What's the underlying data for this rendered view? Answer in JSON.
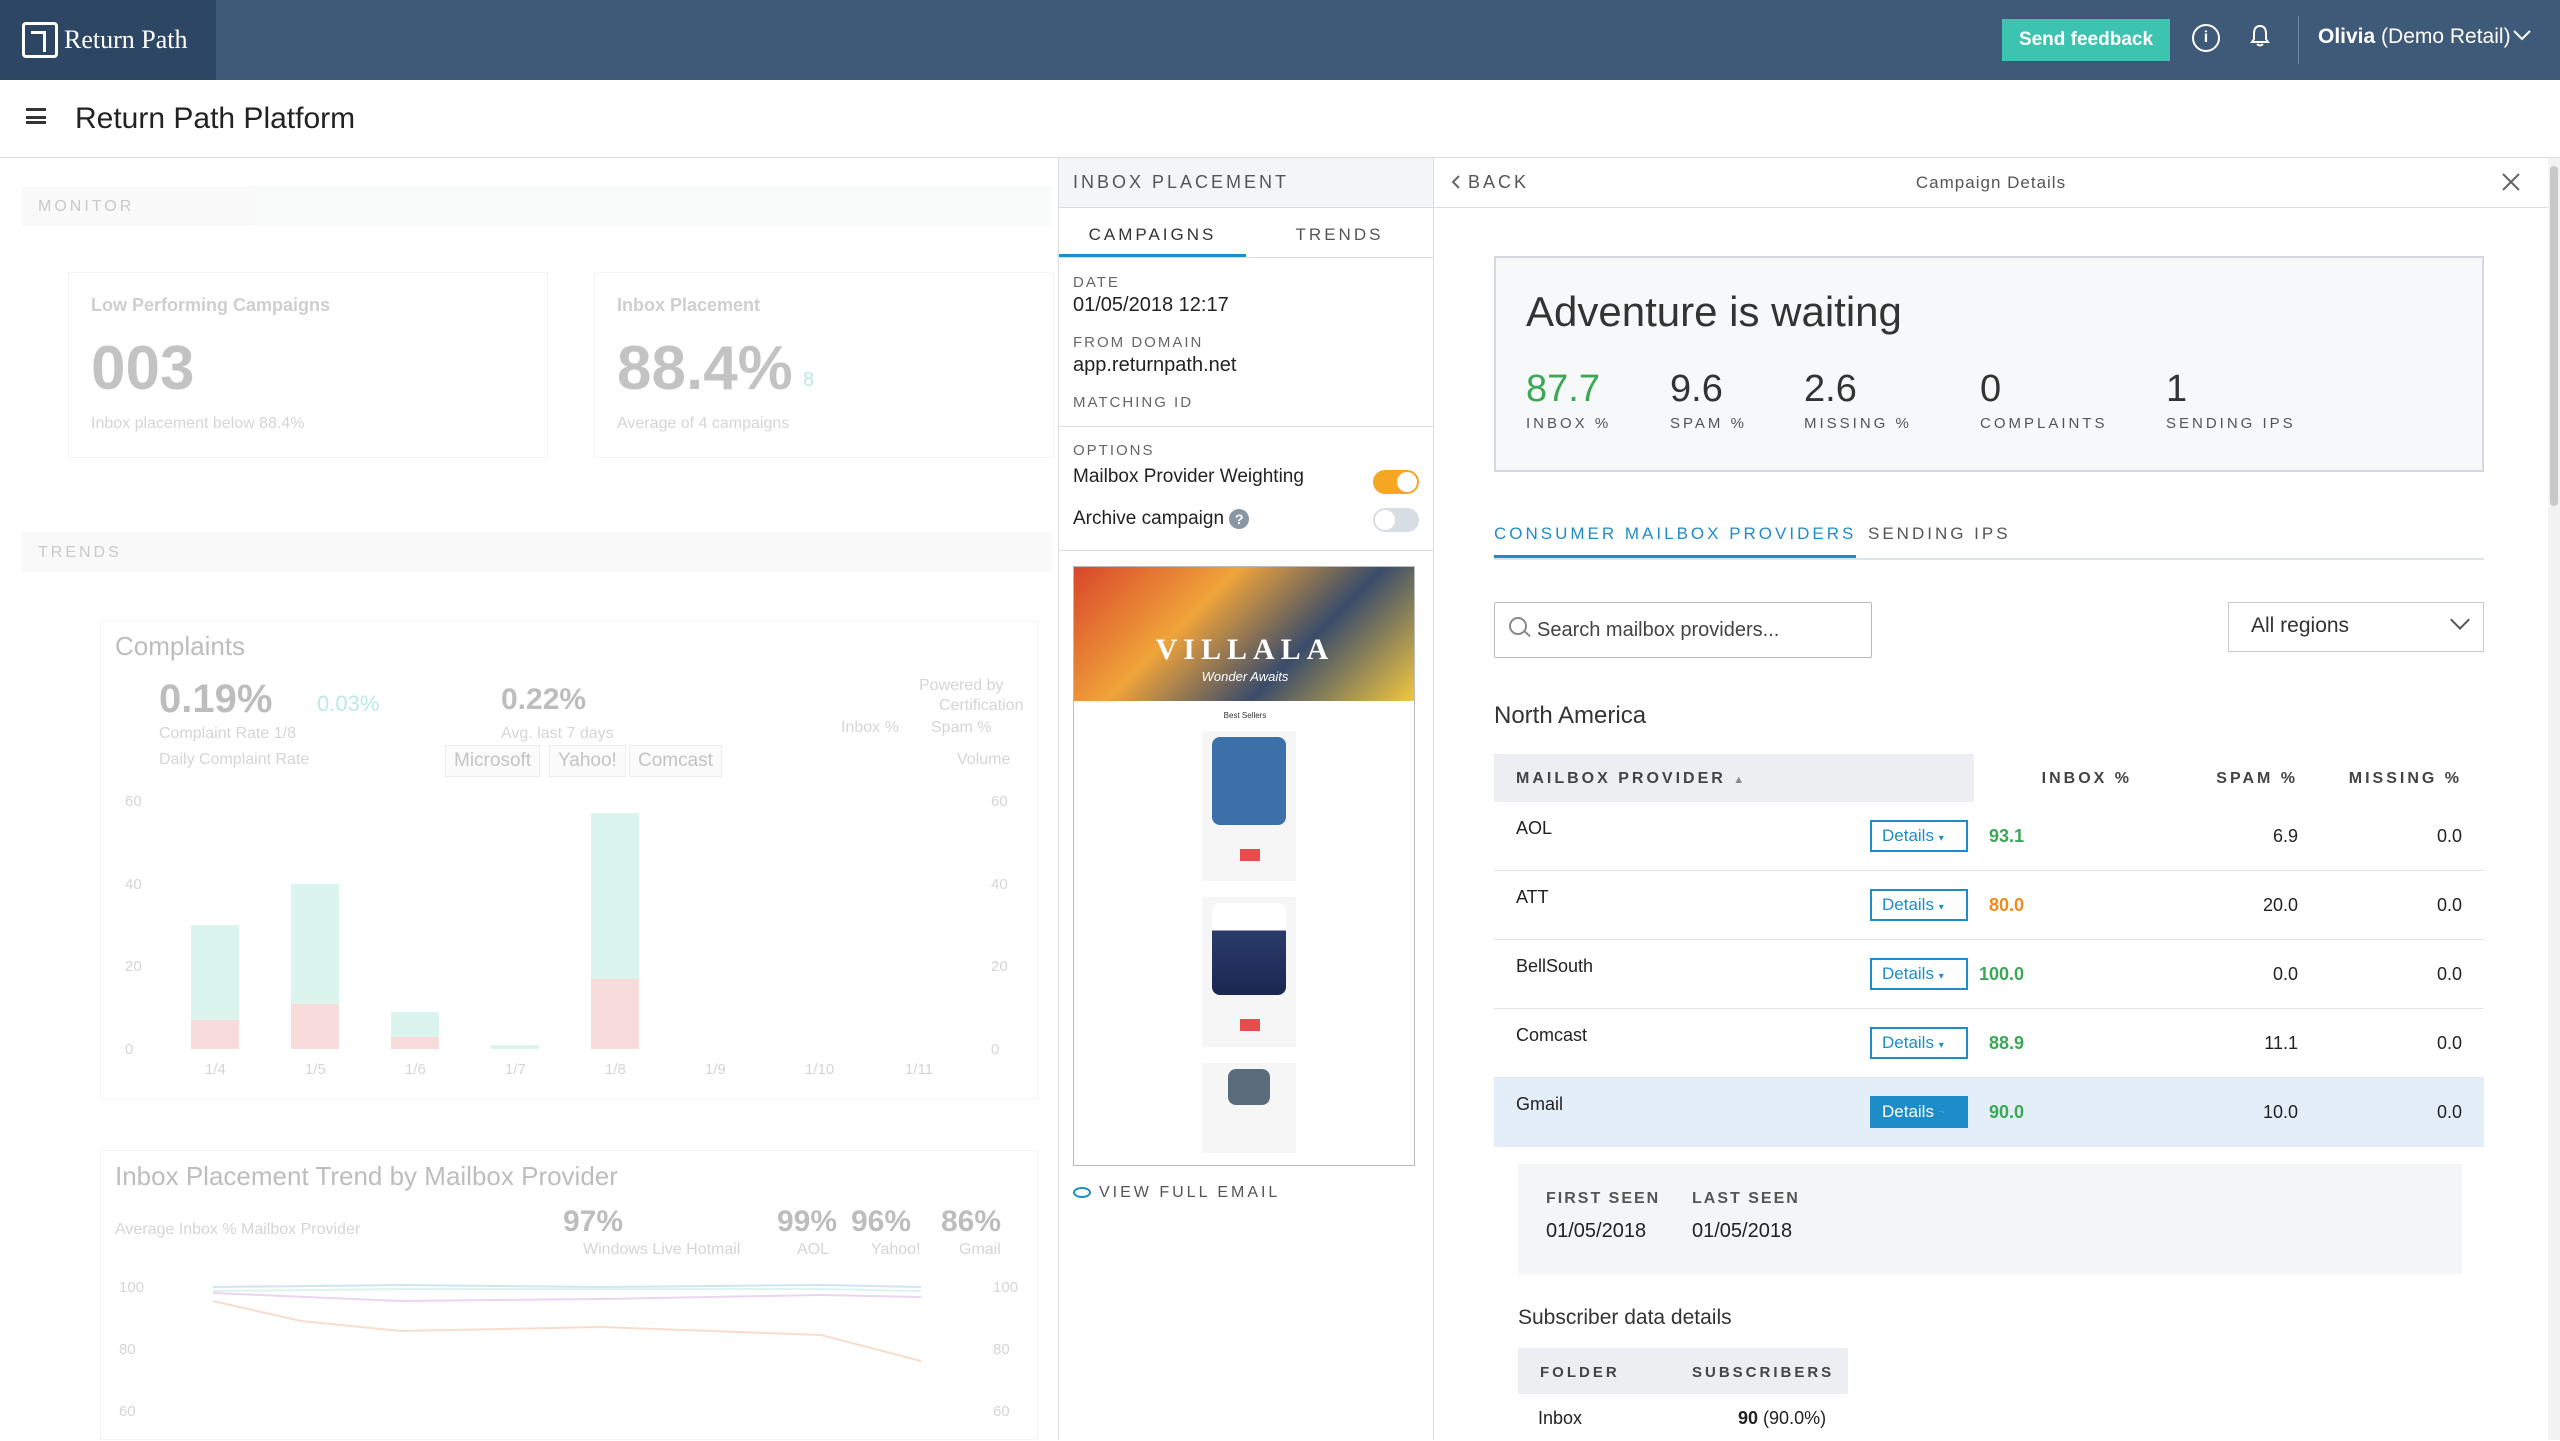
{
  "topbar": {
    "brand": "Return Path",
    "feedback_button": "Send feedback",
    "user_name": "Olivia",
    "user_org": " (Demo Retail)"
  },
  "subbar": {
    "title": "Return Path Platform"
  },
  "dashboard": {
    "monitor_label": "MONITOR",
    "low_perf_title": "Low Performing Campaigns",
    "low_perf_value": "003",
    "low_perf_sub": "Inbox placement below 88.4%",
    "inbox_title": "Inbox Placement",
    "inbox_value": "88.4%",
    "inbox_delta": "8",
    "inbox_sub": "Average of 4 campaigns",
    "trends_label": "TRENDS",
    "complaints_title": "Complaints",
    "complaints_rate": "0.19%",
    "complaints_delta": "0.03%",
    "complaints_rate_label": "Complaint Rate 1/8",
    "complaints_avg": "0.22%",
    "complaints_avg_label": "Avg. last 7 days",
    "powered_by": "Powered by",
    "certification": "Certification",
    "legend_inbox": "Inbox %",
    "legend_spam": "Spam %",
    "daily_rate_label": "Daily Complaint Rate",
    "volume_label": "Volume",
    "provider_tabs": [
      "Microsoft",
      "Yahoo!",
      "Comcast"
    ],
    "trend_title": "Inbox Placement Trend by Mailbox Provider",
    "trend_sub": "Average Inbox % Mailbox Provider",
    "trend_stats": [
      {
        "value": "97%",
        "label": "Windows Live Hotmail"
      },
      {
        "value": "99%",
        "label": "AOL"
      },
      {
        "value": "96%",
        "label": "Yahoo!"
      },
      {
        "value": "86%",
        "label": "Gmail"
      }
    ]
  },
  "chart_data": [
    {
      "type": "bar",
      "title": "Complaints",
      "categories": [
        "1/4",
        "1/5",
        "1/6",
        "1/7",
        "1/8",
        "1/9",
        "1/10",
        "1/11"
      ],
      "series": [
        {
          "name": "Inbox %",
          "values": [
            30,
            40,
            9,
            1,
            57,
            0,
            0,
            0
          ]
        },
        {
          "name": "Spam %",
          "values": [
            7,
            11,
            3,
            0,
            17,
            0,
            0,
            0
          ]
        }
      ],
      "y_ticks": [
        "60",
        "40",
        "20",
        "0"
      ],
      "ylim": [
        0,
        60
      ]
    },
    {
      "type": "line",
      "title": "Inbox Placement Trend by Mailbox Provider",
      "y_ticks": [
        "100",
        "80",
        "60"
      ],
      "ylim": [
        60,
        100
      ]
    }
  ],
  "middle": {
    "header": "INBOX PLACEMENT",
    "tabs": [
      "CAMPAIGNS",
      "TRENDS"
    ],
    "date_label": "DATE",
    "date_value": "01/05/2018 12:17",
    "from_label": "FROM DOMAIN",
    "from_value": "app.returnpath.net",
    "matching_label": "MATCHING ID",
    "options_label": "OPTIONS",
    "option_weighting": "Mailbox Provider Weighting",
    "option_weighting_on": true,
    "option_archive": "Archive campaign",
    "option_archive_on": false,
    "email_brand": "VILLALA",
    "email_tagline": "Wonder Awaits",
    "email_best": "Best Sellers",
    "view_full": "VIEW FULL EMAIL"
  },
  "right": {
    "back": "BACK",
    "title": "Campaign Details",
    "campaign_name": "Adventure is waiting",
    "metrics": [
      {
        "value": "87.7",
        "label": "INBOX %"
      },
      {
        "value": "9.6",
        "label": "SPAM %"
      },
      {
        "value": "2.6",
        "label": "MISSING %"
      },
      {
        "value": "0",
        "label": "COMPLAINTS"
      },
      {
        "value": "1",
        "label": "SENDING IPS"
      }
    ],
    "tabs": [
      "CONSUMER MAILBOX PROVIDERS",
      "SENDING IPS"
    ],
    "search_placeholder": "Search mailbox providers...",
    "region": "All regions",
    "region_title": "North America",
    "columns": [
      "MAILBOX PROVIDER",
      "INBOX %",
      "SPAM %",
      "MISSING %"
    ],
    "details_label": "Details",
    "rows": [
      {
        "name": "AOL",
        "inbox": "93.1",
        "spam": "6.9",
        "missing": "0.0",
        "color": "#3aa856"
      },
      {
        "name": "ATT",
        "inbox": "80.0",
        "spam": "20.0",
        "missing": "0.0",
        "color": "#f08a1a"
      },
      {
        "name": "BellSouth",
        "inbox": "100.0",
        "spam": "0.0",
        "missing": "0.0",
        "color": "#3aa856"
      },
      {
        "name": "Comcast",
        "inbox": "88.9",
        "spam": "11.1",
        "missing": "0.0",
        "color": "#3aa856"
      },
      {
        "name": "Gmail",
        "inbox": "90.0",
        "spam": "10.0",
        "missing": "0.0",
        "color": "#3aa856"
      }
    ],
    "first_seen_label": "FIRST SEEN",
    "first_seen": "01/05/2018",
    "last_seen_label": "LAST SEEN",
    "last_seen": "01/05/2018",
    "subscriber_title": "Subscriber data details",
    "subs_columns": [
      "FOLDER",
      "SUBSCRIBERS"
    ],
    "subs_row": {
      "folder": "Inbox",
      "count": "90",
      "pct": "(90.0%)"
    }
  }
}
